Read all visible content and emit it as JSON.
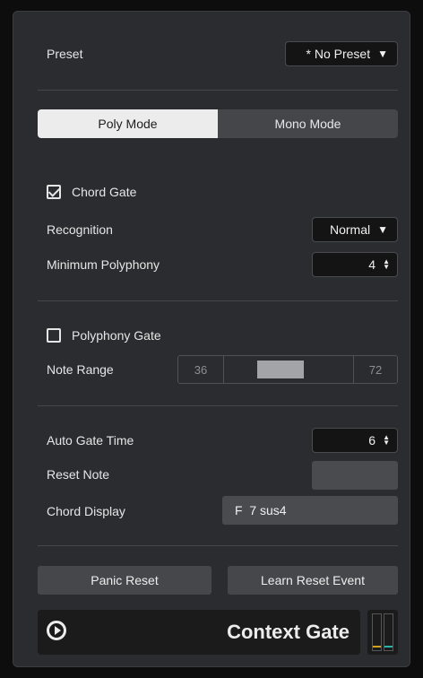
{
  "preset": {
    "label": "Preset",
    "value": "* No Preset",
    "caret": "▼"
  },
  "modes": {
    "poly": "Poly Mode",
    "mono": "Mono Mode",
    "active": "poly"
  },
  "chord_gate": {
    "label": "Chord Gate",
    "checked": true,
    "recognition_label": "Recognition",
    "recognition_value": "Normal",
    "min_poly_label": "Minimum Polyphony",
    "min_poly_value": "4"
  },
  "polyphony_gate": {
    "label": "Polyphony Gate",
    "checked": false,
    "note_range_label": "Note Range",
    "range_low": "36",
    "range_high": "72"
  },
  "settings": {
    "auto_gate_label": "Auto Gate Time",
    "auto_gate_value": "6",
    "reset_note_label": "Reset Note",
    "reset_note_value": "",
    "chord_display_label": "Chord Display",
    "chord_display_value": "F  7 sus4"
  },
  "buttons": {
    "panic": "Panic Reset",
    "learn": "Learn Reset Event"
  },
  "footer": {
    "title": "Context Gate",
    "logo": "play-circle-icon"
  },
  "colors": {
    "meter_left": "#d4a11e",
    "meter_right": "#2bb5a8"
  }
}
